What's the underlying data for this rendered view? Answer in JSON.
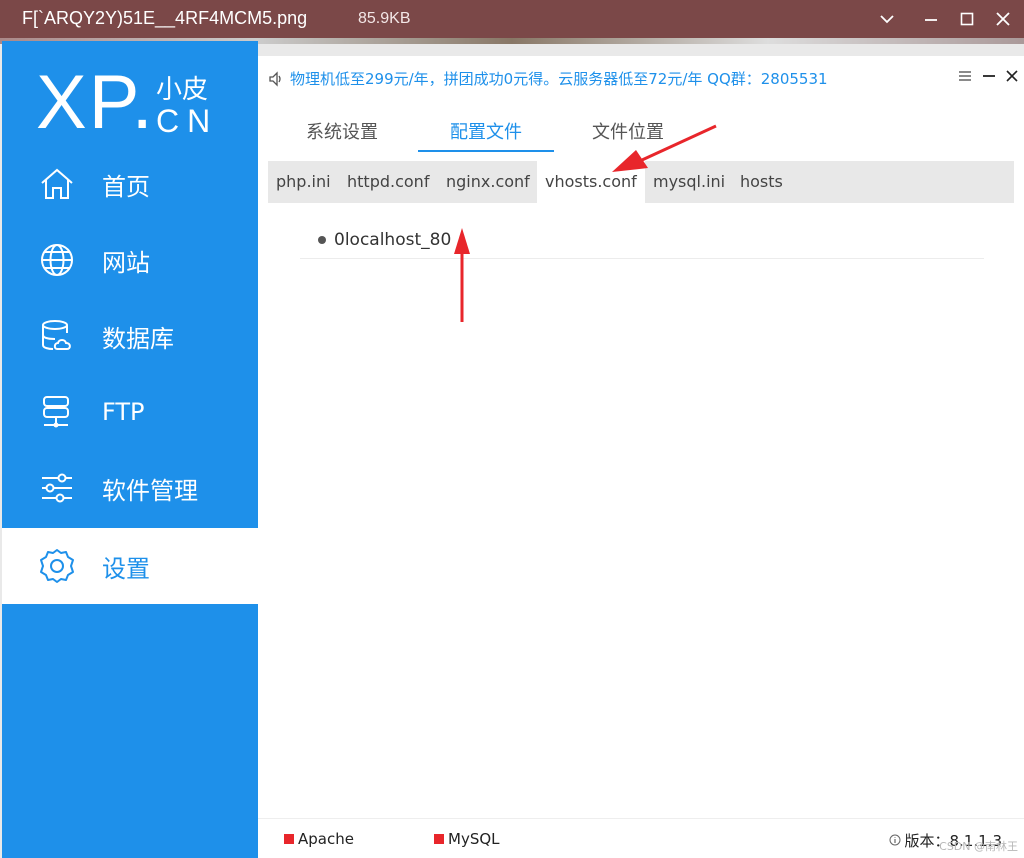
{
  "viewer": {
    "filename": "F[`ARQY2Y)51E__4RF4MCM5.png",
    "filesize": "85.9KB"
  },
  "logo": {
    "brand": "XP.",
    "small": "小皮",
    "cn": "CN"
  },
  "sidebar": {
    "items": [
      {
        "label": "首页",
        "icon": "home-icon"
      },
      {
        "label": "网站",
        "icon": "globe-icon"
      },
      {
        "label": "数据库",
        "icon": "database-icon"
      },
      {
        "label": "FTP",
        "icon": "ftp-server-icon"
      },
      {
        "label": "软件管理",
        "icon": "sliders-icon"
      },
      {
        "label": "设置",
        "icon": "gear-icon",
        "active": true
      }
    ]
  },
  "header": {
    "announcement": "物理机低至299元/年，拼团成功0元得。云服务器低至72元/年 QQ群：2805531"
  },
  "top_tabs": [
    "系统设置",
    "配置文件",
    "文件位置"
  ],
  "top_tabs_active": "配置文件",
  "sub_tabs": [
    "php.ini",
    "httpd.conf",
    "nginx.conf",
    "vhosts.conf",
    "mysql.ini",
    "hosts"
  ],
  "sub_tabs_active": "vhosts.conf",
  "files": [
    "0localhost_80"
  ],
  "status": {
    "services": [
      "Apache",
      "MySQL"
    ],
    "version_label": "版本：",
    "version": "8.1.1.3",
    "watermark": "CSDN @南林王"
  },
  "colors": {
    "accent": "#1e90ea",
    "viewer_bar": "#7b4848",
    "service_dot": "#e8262b",
    "annotation_arrow": "#e8262b"
  }
}
